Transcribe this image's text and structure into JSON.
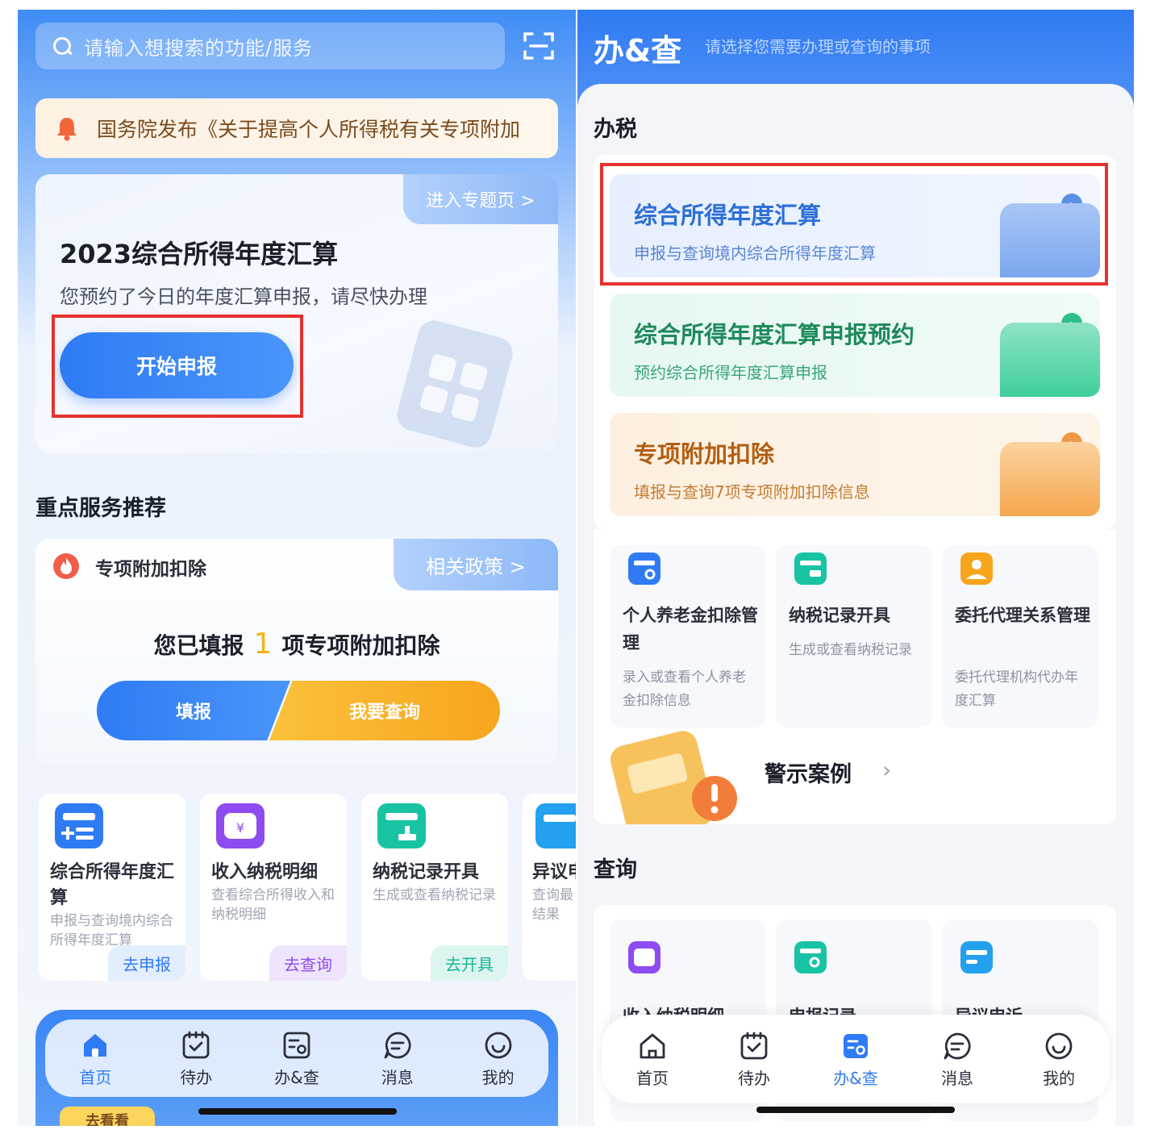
{
  "left": {
    "search": {
      "placeholder": "请输入想搜索的功能/服务"
    },
    "notice": {
      "text": "国务院发布《关于提高个人所得税有关专项附加"
    },
    "annual_card": {
      "topic_link": "进入专题页 >",
      "title": "2023综合所得年度汇算",
      "subtitle": "您预约了今日的年度汇算申报，请尽快办理",
      "start_button": "开始申报"
    },
    "key_services_title": "重点服务推荐",
    "deduction_card": {
      "name": "专项附加扣除",
      "policy_link": "相关政策 >",
      "filled_prefix": "您已填报",
      "filled_count": "1",
      "filled_suffix": "项专项附加扣除",
      "fill_button": "填报",
      "query_button": "我要查询"
    },
    "services": [
      {
        "title": "综合所得年度汇算",
        "desc": "申报与查询境内综合所得年度汇算",
        "action": "去申报"
      },
      {
        "title": "收入纳税明细",
        "desc": "查看综合所得收入和纳税明细",
        "action": "去查询"
      },
      {
        "title": "纳税记录开具",
        "desc": "生成或查看纳税记录",
        "action": "去开具"
      },
      {
        "title": "异议申诉",
        "desc": "查询最结果",
        "action": ""
      }
    ],
    "tabbar": [
      {
        "label": "首页",
        "icon": "home-icon",
        "active": true
      },
      {
        "label": "待办",
        "icon": "calendar-check-icon",
        "active": false
      },
      {
        "label": "办&查",
        "icon": "office-query-icon",
        "active": false
      },
      {
        "label": "消息",
        "icon": "message-icon",
        "active": false
      },
      {
        "label": "我的",
        "icon": "profile-icon",
        "active": false
      }
    ],
    "go_see": "去看看"
  },
  "right": {
    "title": "办&查",
    "subtitle": "请选择您需要办理或查询的事项",
    "section_tax": "办税",
    "big_cards": [
      {
        "title": "综合所得年度汇算",
        "desc": "申报与查询境内综合所得年度汇算",
        "color": "#2e6fd8"
      },
      {
        "title": "综合所得年度汇算申报预约",
        "desc": "预约综合所得年度汇算申报",
        "color": "#1f8a5c"
      },
      {
        "title": "专项附加扣除",
        "desc": "填报与查询7项专项附加扣除信息",
        "color": "#b35e12"
      }
    ],
    "mini_cards": [
      {
        "title": "个人养老金扣除管理",
        "desc": "录入或查看个人养老金扣除信息"
      },
      {
        "title": "纳税记录开具",
        "desc": "生成或查看纳税记录"
      },
      {
        "title": "委托代理关系管理",
        "desc": "委托代理机构代办年度汇算"
      }
    ],
    "warning_cases": "警示案例",
    "section_query": "查询",
    "query_items": [
      {
        "title": "收入纳税明细"
      },
      {
        "title": "申报记录"
      },
      {
        "title": "异议申诉"
      }
    ],
    "tabbar": [
      {
        "label": "首页",
        "icon": "home-icon",
        "active": false
      },
      {
        "label": "待办",
        "icon": "calendar-check-icon",
        "active": false
      },
      {
        "label": "办&查",
        "icon": "office-query-icon",
        "active": true
      },
      {
        "label": "消息",
        "icon": "message-icon",
        "active": false
      },
      {
        "label": "我的",
        "icon": "profile-icon",
        "active": false
      }
    ]
  },
  "colors": {
    "primary": "#2f7bf4",
    "highlight_box": "#e5312d",
    "accent_orange": "#f7a51d"
  }
}
